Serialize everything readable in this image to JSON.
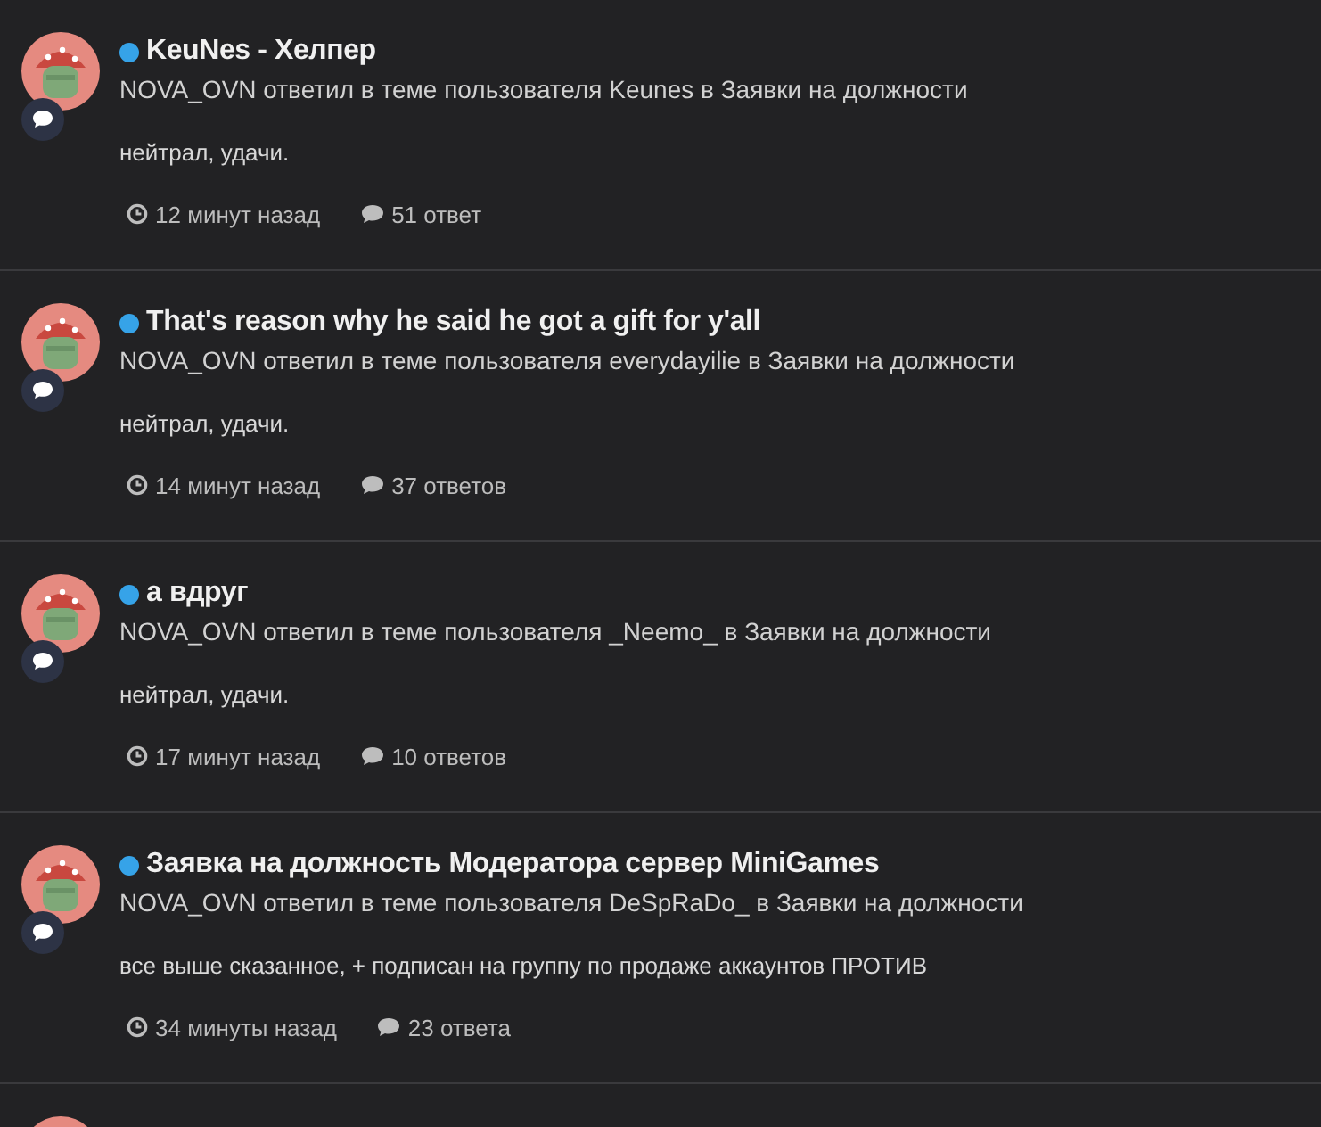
{
  "activity": [
    {
      "title": "KeuNes - Хелпер",
      "unread": true,
      "summary": "NOVA_OVN ответил в теме пользователя Keunes в Заявки на должности",
      "snippet": "нейтрал, удачи.",
      "time": "12 минут назад",
      "replies": "51 ответ"
    },
    {
      "title": "That's reason why he said he got a gift for y'all",
      "unread": true,
      "summary": "NOVA_OVN ответил в теме пользователя everydayilie в Заявки на должности",
      "snippet": "нейтрал, удачи.",
      "time": "14 минут назад",
      "replies": "37 ответов"
    },
    {
      "title": "а вдруг",
      "unread": true,
      "summary": "NOVA_OVN ответил в теме пользователя _Neemo_ в Заявки на должности",
      "snippet": "нейтрал, удачи.",
      "time": "17 минут назад",
      "replies": "10 ответов"
    },
    {
      "title": "Заявка на должность Модератора сервер MiniGames",
      "unread": true,
      "summary": "NOVA_OVN ответил в теме пользователя DeSpRaDo_ в Заявки на должности",
      "snippet": "все выше сказанное, + подписан на группу по продаже аккаунтов ПРОТИВ",
      "time": "34 минуты назад",
      "replies": "23 ответа"
    }
  ]
}
